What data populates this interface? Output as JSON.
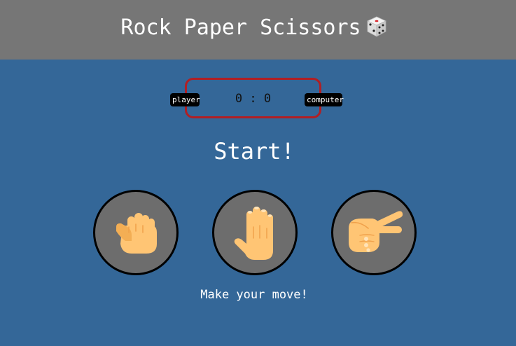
{
  "header": {
    "title": "Rock Paper Scissors",
    "icon": "dice-icon"
  },
  "scoreboard": {
    "player_label": "player",
    "computer_label": "computer",
    "player_score": "0",
    "separator": ":",
    "computer_score": "0",
    "border_color": "#b11f24"
  },
  "result": {
    "text": "Start!"
  },
  "choices": [
    {
      "id": "rock",
      "icon": "rock-hand-icon"
    },
    {
      "id": "paper",
      "icon": "paper-hand-icon"
    },
    {
      "id": "scissors",
      "icon": "scissors-hand-icon"
    }
  ],
  "message": {
    "text": "Make your move!"
  },
  "colors": {
    "background": "#346798",
    "header": "#767676",
    "choice_fill": "#6d6d6d",
    "skin": "#ffc574"
  }
}
